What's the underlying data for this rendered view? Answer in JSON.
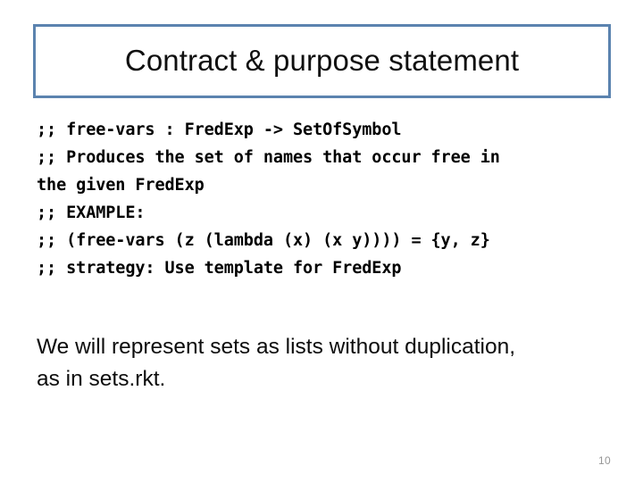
{
  "slide": {
    "title": "Contract & purpose statement",
    "accent_color": "#5b83af",
    "background_color": "#ffffff",
    "page_number": "10",
    "page_number_color": "#969696",
    "code_block": {
      "language": "racket",
      "lines": [
        ";; free-vars : FredExp -> SetOfSymbol",
        ";; Produces the set of names that occur free in",
        "the given FredExp",
        ";; EXAMPLE:",
        ";; (free-vars (z (lambda (x) (x y)))) = {y, z}",
        ";; strategy: Use template for FredExp"
      ]
    },
    "body": {
      "paragraph": "We will represent sets as lists without duplication, as in sets.rkt."
    }
  }
}
